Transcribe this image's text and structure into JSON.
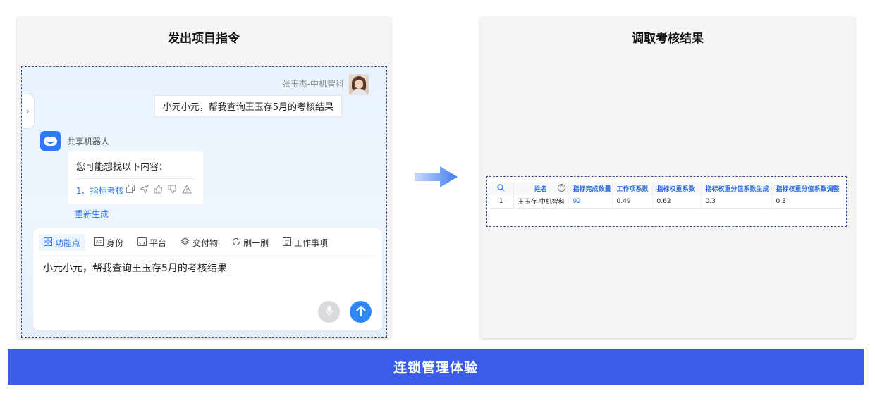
{
  "left_panel": {
    "title": "发出项目指令",
    "user": {
      "name": "张玉杰-中机智科",
      "message": "小元小元，帮我查询王玉存5月的考核结果"
    },
    "bot": {
      "name": "共享机器人",
      "question": "您可能想找以下内容：",
      "suggestion": "1、指标考核",
      "regenerate": "重新生成"
    },
    "toolbar": [
      {
        "label": "功能点",
        "icon": "grid-icon"
      },
      {
        "label": "身份",
        "icon": "id-card-icon"
      },
      {
        "label": "平台",
        "icon": "code-window-icon"
      },
      {
        "label": "交付物",
        "icon": "layers-icon"
      },
      {
        "label": "刷一刷",
        "icon": "refresh-icon"
      },
      {
        "label": "工作事项",
        "icon": "task-list-icon"
      }
    ],
    "input_text": "小元小元，帮我查询王玉存5月的考核结果"
  },
  "right_panel": {
    "title": "调取考核结果",
    "table": {
      "headers": [
        "姓名",
        "指标完成数量",
        "工作项系数",
        "指标权重系数",
        "指标权重分值系数生成",
        "指标权重分值系数调整"
      ],
      "rows": [
        [
          "1",
          "王玉存-中机智科",
          "92",
          "0.49",
          "0.62",
          "0.3",
          "0.3"
        ]
      ]
    }
  },
  "footer": {
    "label": "连锁管理体验"
  },
  "colors": {
    "accent": "#2f7cf6",
    "footer_bg": "#3b5ce6",
    "dashed_border": "#3a4e9c"
  }
}
